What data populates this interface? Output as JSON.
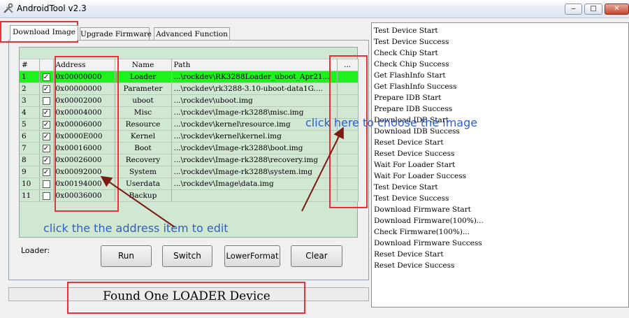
{
  "window": {
    "title": "AndroidTool v2.3",
    "minimize_glyph": "‒",
    "maximize_glyph": "□",
    "close_glyph": "✕",
    "icon": "wrench-screwdriver-icon"
  },
  "tabs": [
    {
      "label": "Download Image",
      "active": true
    },
    {
      "label": "Upgrade Firmware",
      "active": false
    },
    {
      "label": "Advanced Function",
      "active": false
    }
  ],
  "table": {
    "columns": [
      "#",
      "",
      "Address",
      "Name",
      "Path",
      "..."
    ],
    "rows": [
      {
        "num": "1",
        "checked": true,
        "address": "0x00000000",
        "name": "Loader",
        "path": "...\\rockdev\\RK3288Loader_uboot_Apr21...",
        "selected": true
      },
      {
        "num": "2",
        "checked": true,
        "address": "0x00000000",
        "name": "Parameter",
        "path": "...\\rockdev\\rk3288-3.10-uboot-data1G...."
      },
      {
        "num": "3",
        "checked": false,
        "address": "0x00002000",
        "name": "uboot",
        "path": "...\\rockdev\\uboot.img"
      },
      {
        "num": "4",
        "checked": true,
        "address": "0x00004000",
        "name": "Misc",
        "path": "...\\rockdev\\Image-rk3288\\misc.img"
      },
      {
        "num": "5",
        "checked": true,
        "address": "0x00006000",
        "name": "Resource",
        "path": "...\\rockdev\\kernel\\resource.img"
      },
      {
        "num": "6",
        "checked": true,
        "address": "0x0000E000",
        "name": "Kernel",
        "path": "...\\rockdev\\kernel\\kernel.img"
      },
      {
        "num": "7",
        "checked": true,
        "address": "0x00016000",
        "name": "Boot",
        "path": "...\\rockdev\\Image-rk3288\\boot.img"
      },
      {
        "num": "8",
        "checked": true,
        "address": "0x00026000",
        "name": "Recovery",
        "path": "...\\rockdev\\Image-rk3288\\recovery.img"
      },
      {
        "num": "9",
        "checked": true,
        "address": "0x00092000",
        "name": "System",
        "path": "...\\rockdev\\Image-rk3288\\system.img"
      },
      {
        "num": "10",
        "checked": false,
        "address": "0x00194000",
        "name": "Userdata",
        "path": "...\\rockdev\\Image\\data.img"
      },
      {
        "num": "11",
        "checked": false,
        "address": "0x00036000",
        "name": "Backup",
        "path": ""
      }
    ]
  },
  "loader_label": "Loader:",
  "buttons": {
    "run": "Run",
    "switch": "Switch",
    "lower_format": "LowerFormat",
    "clear": "Clear"
  },
  "status": "Found One LOADER Device",
  "log": [
    "Test Device Start",
    "Test Device Success",
    "Check Chip Start",
    " Check Chip Success",
    "Get FlashInfo Start",
    "Get FlashInfo Success",
    "Prepare IDB Start",
    "Prepare IDB Success",
    "Download IDB Start",
    "Download IDB Success",
    "Reset Device Start",
    "Reset Device Success",
    "Wait For Loader Start",
    "Wait For Loader Success",
    "Test Device Start",
    "Test Device Success",
    "Download Firmware Start",
    "Download Firmware(100%)...",
    "Check Firmware(100%)...",
    "Download Firmware Success",
    "Reset Device Start",
    "Reset Device Success"
  ],
  "annotations": {
    "choose_image": "click here to choose the image",
    "edit_address": "click the the address item to edit",
    "color": "#2f5ec9",
    "highlight_color": "#e8323a",
    "arrow_color": "#7a1a12"
  },
  "colors": {
    "selected_row": "#1ef11e",
    "grid_bg": "#d0e7d2"
  }
}
